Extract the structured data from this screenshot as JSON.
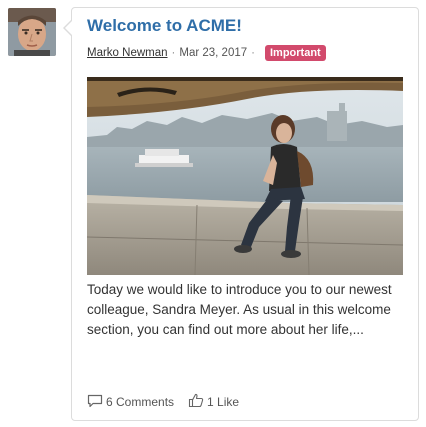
{
  "post": {
    "title": "Welcome to ACME!",
    "author": "Marko Newman",
    "separator": "·",
    "date": "Mar 23, 2017",
    "badge": "Important",
    "body": "Today we would like to introduce you to our newest colleague, Sandra Meyer. As usual in this welcome section, you can find out more about her life,..."
  },
  "actions": {
    "comments": "6 Comments",
    "likes": "1 Like"
  },
  "colors": {
    "title": "#2f6ea8",
    "badge": "#d24a6c",
    "border": "#dcdcdc"
  },
  "icons": {
    "comments": "comment-icon",
    "likes": "thumbs-up-icon"
  }
}
